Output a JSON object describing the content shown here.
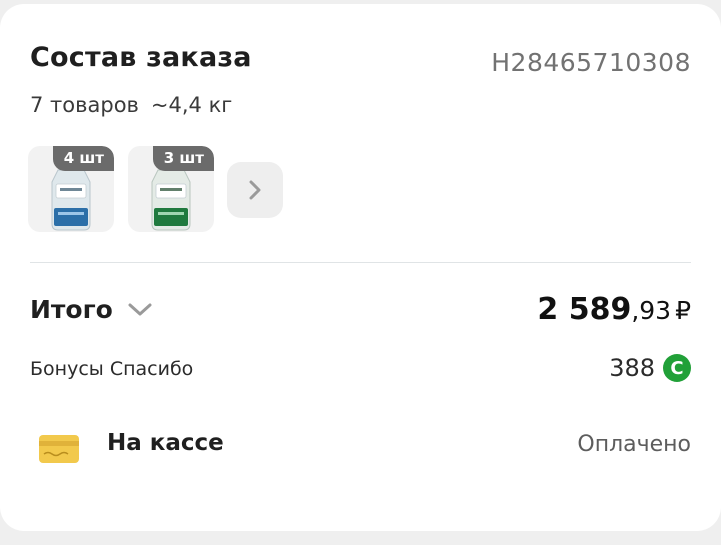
{
  "order": {
    "title": "Состав заказа",
    "id": "H28465710308",
    "items_count": "7 товаров",
    "weight": "~4,4 кг",
    "thumbnails": [
      {
        "qty": "4 шт",
        "icon": "vodka-bottle-blue-label"
      },
      {
        "qty": "3 шт",
        "icon": "vodka-bottle-green-label"
      }
    ],
    "more_icon": "chevron-right-icon"
  },
  "total": {
    "label": "Итого",
    "integer": "2 589",
    "fraction": ",93",
    "currency": "₽"
  },
  "bonus": {
    "label": "Бонусы Спасибо",
    "value": "388",
    "badge": "С"
  },
  "payment": {
    "label": "На кассе",
    "status": "Оплачено",
    "icon": "card-icon"
  },
  "colors": {
    "bonus_badge": "#21a038",
    "card_icon": "#f2c94c",
    "qty_badge": "#6b6b6b"
  }
}
